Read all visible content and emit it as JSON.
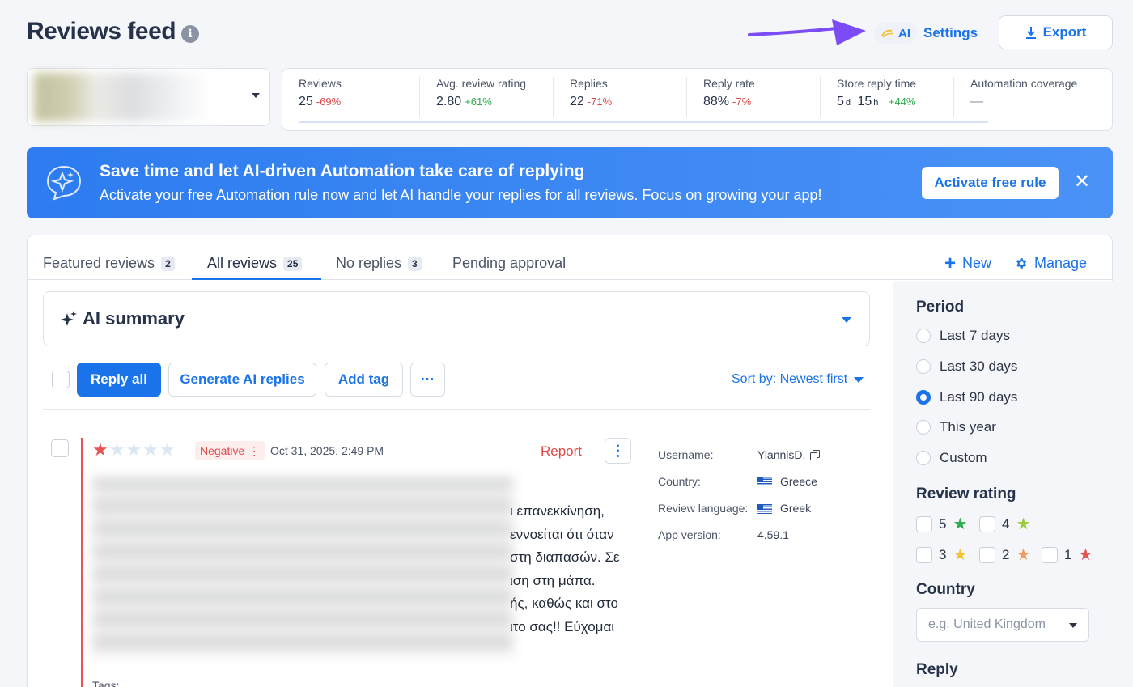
{
  "header": {
    "title": "Reviews feed",
    "info_icon": "info-icon",
    "ai_badge": "AI",
    "settings": "Settings",
    "export": "Export"
  },
  "stats": [
    {
      "label": "Reviews",
      "value": "25",
      "delta": "-69%",
      "trend": "down"
    },
    {
      "label": "Avg. review rating",
      "value": "2.80",
      "delta": "+61%",
      "trend": "up"
    },
    {
      "label": "Replies",
      "value": "22",
      "delta": "-71%",
      "trend": "down"
    },
    {
      "label": "Reply rate",
      "value": "88%",
      "delta": "-7%",
      "trend": "down"
    },
    {
      "label": "Store reply time",
      "value_days": "5",
      "unit_days": "d",
      "value_hours": "15",
      "unit_hours": "h",
      "delta": "+44%",
      "trend": "up"
    },
    {
      "label": "Automation coverage",
      "value": "—"
    }
  ],
  "banner": {
    "title": "Save time and let AI-driven Automation take care of replying",
    "text": "Activate your free Automation rule now and let AI handle your replies for all reviews. Focus on growing your app!",
    "button": "Activate free rule",
    "close": "✕"
  },
  "tabs": [
    {
      "label": "Featured reviews",
      "count": "2"
    },
    {
      "label": "All reviews",
      "count": "25",
      "active": true
    },
    {
      "label": "No replies",
      "count": "3"
    },
    {
      "label": "Pending approval"
    }
  ],
  "tab_actions": {
    "new": "New",
    "manage": "Manage"
  },
  "ai_summary": {
    "label": "AI summary"
  },
  "toolbar": {
    "reply_all": "Reply all",
    "generate": "Generate AI replies",
    "add_tag": "Add tag",
    "more": "···",
    "sort": "Sort by: Newest first"
  },
  "review": {
    "rating": 1,
    "sentiment": "Negative",
    "date": "Oct 31, 2025, 2:49 PM",
    "report": "Report",
    "more": "⋮",
    "visible_text": "ι επανεκκίνηση,\nεννοείται ότι όταν\nστη διαπασών. Σε\nιση στη μάπα.\nής, καθώς και στο\nιτο σας!! Εύχομαι",
    "tags_label": "Tags:",
    "meta": [
      {
        "key": "Username:",
        "value": "YiannisD."
      },
      {
        "key": "Country:",
        "value": "Greece"
      },
      {
        "key": "Review language:",
        "value": "Greek"
      },
      {
        "key": "App version:",
        "value": "4.59.1"
      }
    ]
  },
  "sidebar": {
    "period_title": "Period",
    "period_options": [
      "Last 7 days",
      "Last 30 days",
      "Last 90 days",
      "This year",
      "Custom"
    ],
    "period_selected": "Last 90 days",
    "rating_title": "Review rating",
    "ratings": [
      "5",
      "4",
      "3",
      "2",
      "1"
    ],
    "rating_colors": {
      "5": "#2eaa4f",
      "4": "#9ccc3c",
      "3": "#f2c230",
      "2": "#f49a5f",
      "1": "#e85252"
    },
    "country_title": "Country",
    "country_placeholder": "e.g. United Kingdom",
    "reply_title": "Reply"
  },
  "colors": {
    "accent": "#1a73e8",
    "negative": "#e04848",
    "positive": "#2eaa4f"
  }
}
